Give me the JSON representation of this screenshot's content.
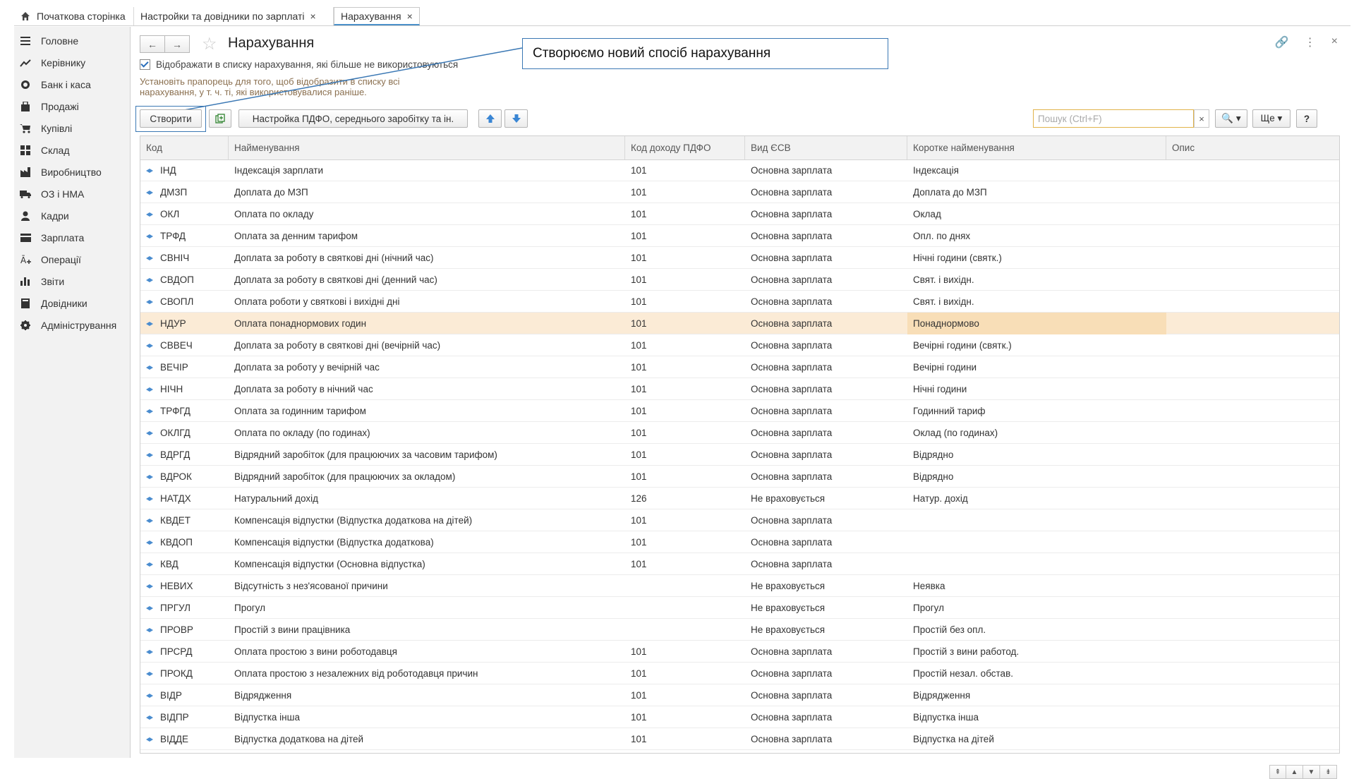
{
  "tabs": {
    "home": "Початкова сторінка",
    "settings": "Настройки та довідники по зарплаті",
    "active": "Нарахування",
    "close_symbol": "×"
  },
  "sidebar": {
    "items": [
      {
        "label": "Головне",
        "icon": "menu-icon"
      },
      {
        "label": "Керівнику",
        "icon": "trend-icon"
      },
      {
        "label": "Банк і каса",
        "icon": "coins-icon"
      },
      {
        "label": "Продажі",
        "icon": "bag-icon"
      },
      {
        "label": "Купівлі",
        "icon": "cart-icon"
      },
      {
        "label": "Склад",
        "icon": "warehouse-icon"
      },
      {
        "label": "Виробництво",
        "icon": "factory-icon"
      },
      {
        "label": "ОЗ і НМА",
        "icon": "truck-icon"
      },
      {
        "label": "Кадри",
        "icon": "person-icon"
      },
      {
        "label": "Зарплата",
        "icon": "wallet-icon"
      },
      {
        "label": "Операції",
        "icon": "operations-icon"
      },
      {
        "label": "Звіти",
        "icon": "bar-chart-icon"
      },
      {
        "label": "Довідники",
        "icon": "book-icon"
      },
      {
        "label": "Адміністрування",
        "icon": "gear-icon"
      }
    ]
  },
  "header": {
    "title": "Нарахування",
    "back_symbol": "←",
    "forward_symbol": "→",
    "link_symbol": "🔗",
    "more_symbol": "⋮",
    "close_symbol": "×"
  },
  "filter": {
    "checkbox_label": "Відображати в списку нарахування, які більше не використовуються",
    "hint": "Установіть прапорець для того, щоб відобразити в списку всі нарахування, у т. ч. ті, які використовувалися раніше."
  },
  "callout": {
    "text": "Створюємо новий спосіб нарахування"
  },
  "toolbar": {
    "create_label": "Створити",
    "settings_label": "Настройка ПДФО, середнього заробітку та ін.",
    "search_placeholder": "Пошук (Ctrl+F)",
    "clear_symbol": "×",
    "find_symbol": "🔍 ▾",
    "more_label": "Ще ▾",
    "help_label": "?"
  },
  "table": {
    "columns": [
      "Код",
      "Найменування",
      "Код доходу ПДФО",
      "Вид ЄСВ",
      "Коротке найменування",
      "Опис"
    ],
    "selected_index": 7,
    "rows": [
      [
        "ІНД",
        "Індексація зарплати",
        "101",
        "Основна зарплата",
        "Індексація",
        ""
      ],
      [
        "ДМЗП",
        "Доплата до МЗП",
        "101",
        "Основна зарплата",
        "Доплата до МЗП",
        ""
      ],
      [
        "ОКЛ",
        "Оплата по окладу",
        "101",
        "Основна зарплата",
        "Оклад",
        ""
      ],
      [
        "ТРФД",
        "Оплата за денним тарифом",
        "101",
        "Основна зарплата",
        "Опл. по днях",
        ""
      ],
      [
        "СВНІЧ",
        "Доплата за роботу в святкові дні (нічний час)",
        "101",
        "Основна зарплата",
        "Нічні години (святк.)",
        ""
      ],
      [
        "СВДОП",
        "Доплата за роботу в святкові дні (денний час)",
        "101",
        "Основна зарплата",
        "Свят. і вихідн.",
        ""
      ],
      [
        "СВОПЛ",
        "Оплата роботи у святкові і вихідні дні",
        "101",
        "Основна зарплата",
        "Свят. і вихідн.",
        ""
      ],
      [
        "НДУР",
        "Оплата понаднормових годин",
        "101",
        "Основна зарплата",
        "Понаднормово",
        ""
      ],
      [
        "СВВЕЧ",
        "Доплата за роботу в святкові дні (вечірній час)",
        "101",
        "Основна зарплата",
        "Вечірні години (святк.)",
        ""
      ],
      [
        "ВЕЧІР",
        "Доплата за роботу у вечірній час",
        "101",
        "Основна зарплата",
        "Вечірні години",
        ""
      ],
      [
        "НІЧН",
        "Доплата за роботу в нічний час",
        "101",
        "Основна зарплата",
        "Нічні години",
        ""
      ],
      [
        "ТРФГД",
        "Оплата за годинним тарифом",
        "101",
        "Основна зарплата",
        "Годинний тариф",
        ""
      ],
      [
        "ОКЛГД",
        "Оплата по окладу (по годинах)",
        "101",
        "Основна зарплата",
        "Оклад (по годинах)",
        ""
      ],
      [
        "ВДРГД",
        "Відрядний заробіток (для працюючих за часовим тарифом)",
        "101",
        "Основна зарплата",
        "Відрядно",
        ""
      ],
      [
        "ВДРОК",
        "Відрядний заробіток (для працюючих за окладом)",
        "101",
        "Основна зарплата",
        "Відрядно",
        ""
      ],
      [
        "НАТДХ",
        "Натуральний дохід",
        "126",
        "Не враховується",
        "Натур. дохід",
        ""
      ],
      [
        "КВДЕТ",
        "Компенсація відпустки (Відпустка додаткова на дітей)",
        "101",
        "Основна зарплата",
        "",
        ""
      ],
      [
        "КВДОП",
        "Компенсація відпустки (Відпустка додаткова)",
        "101",
        "Основна зарплата",
        "",
        ""
      ],
      [
        "КВД",
        "Компенсація відпустки (Основна відпустка)",
        "101",
        "Основна зарплата",
        "",
        ""
      ],
      [
        "НЕВИХ",
        "Відсутність з нез'ясованої причини",
        "",
        "Не враховується",
        "Неявка",
        ""
      ],
      [
        "ПРГУЛ",
        "Прогул",
        "",
        "Не враховується",
        "Прогул",
        ""
      ],
      [
        "ПРОВР",
        "Простій з вини працівника",
        "",
        "Не враховується",
        "Простій без опл.",
        ""
      ],
      [
        "ПРСРД",
        "Оплата простою з вини роботодавця",
        "101",
        "Основна зарплата",
        "Простій з вини работод.",
        ""
      ],
      [
        "ПРОКД",
        "Оплата простою з незалежних від роботодавця причин",
        "101",
        "Основна зарплата",
        "Простій незал. обстав.",
        ""
      ],
      [
        "ВІДР",
        "Відрядження",
        "101",
        "Основна зарплата",
        "Відрядження",
        ""
      ],
      [
        "ВІДПР",
        "Відпустка інша",
        "101",
        "Основна зарплата",
        "Відпустка інша",
        ""
      ],
      [
        "ВІДДЕ",
        "Відпустка додаткова на дітей",
        "101",
        "Основна зарплата",
        "Відпустка на дітей",
        ""
      ]
    ]
  },
  "pager": {
    "first": "⇞",
    "up": "▲",
    "down": "▼",
    "last": "⇟"
  },
  "colors": {
    "accent": "#3b78b4",
    "selected_row": "#fbebd6",
    "selected_cell": "#f8deb7",
    "hint_text": "#8b7050",
    "row_marker": "#4a8ccf"
  }
}
